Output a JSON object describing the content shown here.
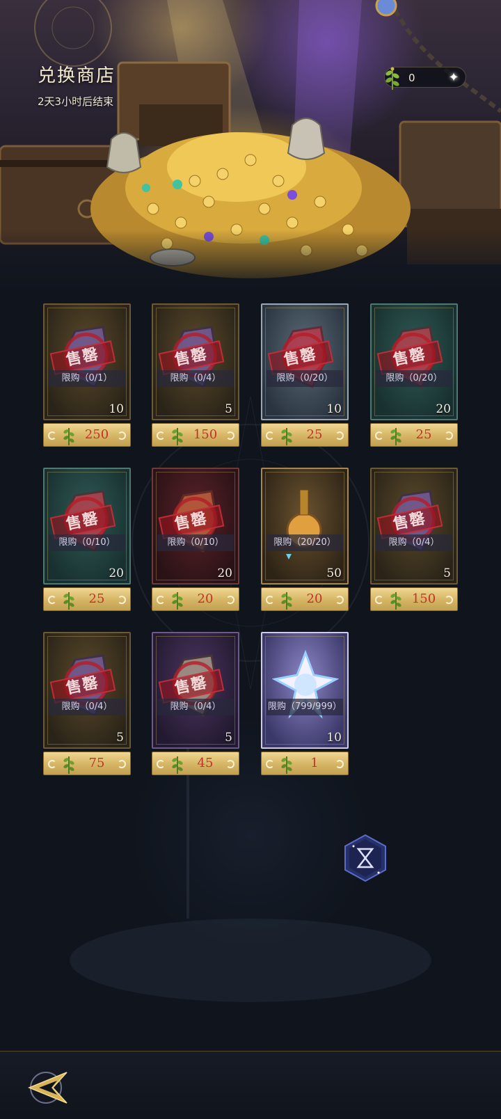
{
  "header": {
    "title": "兑换商店",
    "timer": "2天3小时后结束",
    "currency_value": "0",
    "currency_icon": "herb-token-icon",
    "add_icon": "sparkle-icon"
  },
  "labels": {
    "soldout": "售罄"
  },
  "items": [
    {
      "limit": "限购（0/1）",
      "qty": "10",
      "price": "250",
      "soldout": true,
      "theme": "brown"
    },
    {
      "limit": "限购（0/4）",
      "qty": "5",
      "price": "150",
      "soldout": true,
      "theme": "brown"
    },
    {
      "limit": "限购（0/20）",
      "qty": "10",
      "price": "25",
      "soldout": true,
      "theme": "steel"
    },
    {
      "limit": "限购（0/20）",
      "qty": "20",
      "price": "25",
      "soldout": true,
      "theme": "teal"
    },
    {
      "limit": "限购（0/10）",
      "qty": "20",
      "price": "25",
      "soldout": true,
      "theme": "teal"
    },
    {
      "limit": "限购（0/10）",
      "qty": "20",
      "price": "20",
      "soldout": true,
      "theme": "red"
    },
    {
      "limit": "限购（20/20）",
      "qty": "50",
      "price": "20",
      "soldout": false,
      "theme": "gold"
    },
    {
      "limit": "限购（0/4）",
      "qty": "5",
      "price": "150",
      "soldout": true,
      "theme": "brown"
    },
    {
      "limit": "限购（0/4）",
      "qty": "5",
      "price": "75",
      "soldout": true,
      "theme": "brown"
    },
    {
      "limit": "限购（0/4）",
      "qty": "5",
      "price": "45",
      "soldout": true,
      "theme": "purple"
    },
    {
      "limit": "限购（799/999）",
      "qty": "10",
      "price": "1",
      "soldout": false,
      "theme": "crystal"
    }
  ],
  "colors": {
    "price_text": "#c4312a",
    "price_bg": "#d5b565",
    "soldout_stamp": "#961e2a",
    "background": "#0f141d"
  },
  "floating_button_icon": "hourglass-hex-icon",
  "back_button_icon": "back-arrow-icon"
}
